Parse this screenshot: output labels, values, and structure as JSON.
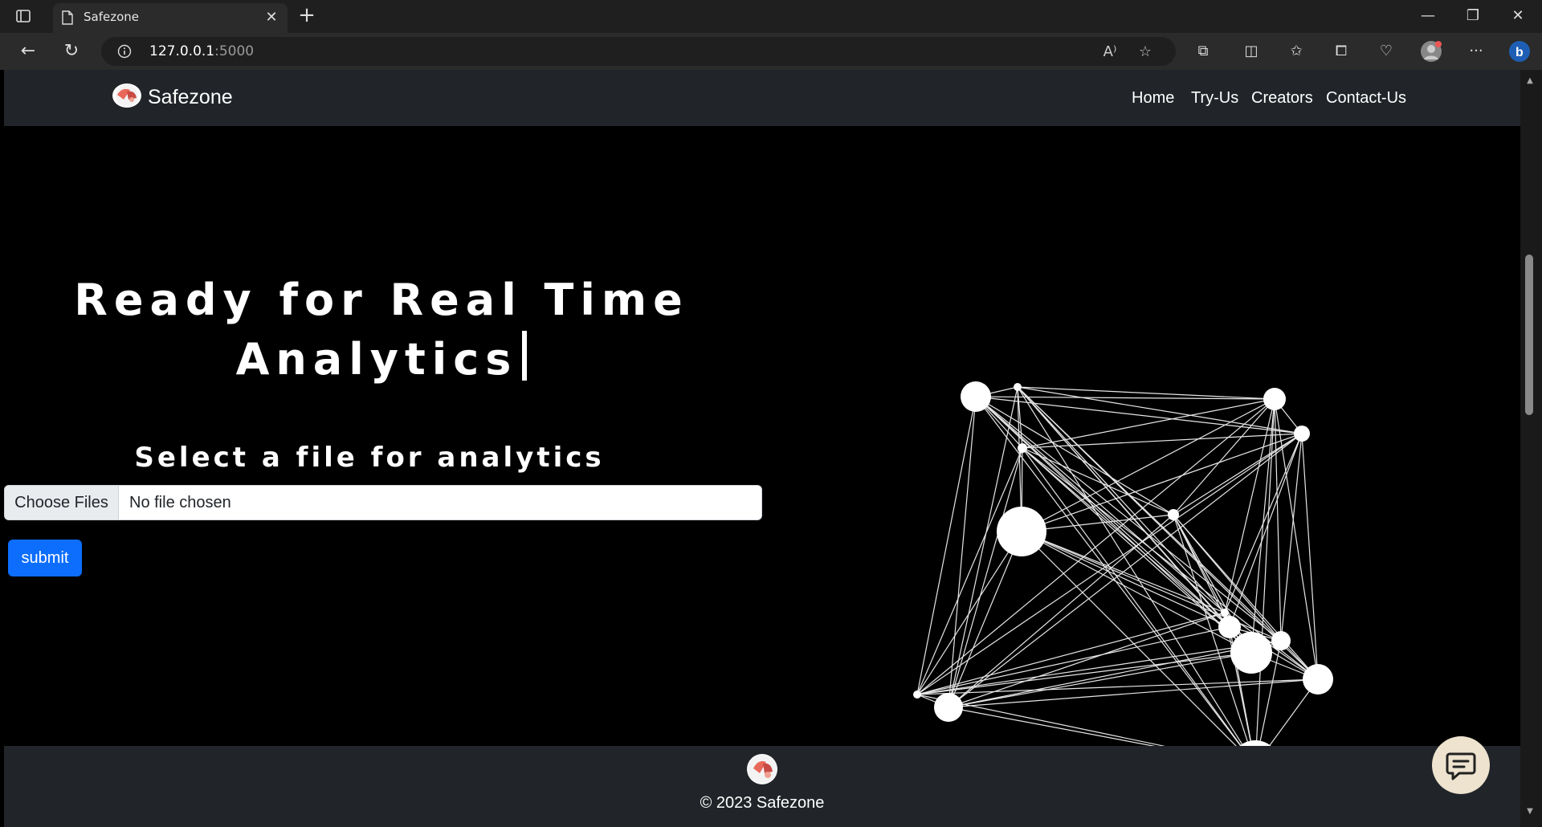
{
  "browser": {
    "tab_title": "Safezone",
    "url_host": "127.0.0.1",
    "url_port": ":5000"
  },
  "page": {
    "brand": "Safezone",
    "nav": [
      "Home",
      "Try-Us",
      "Creators",
      "Contact-Us"
    ],
    "hero_title": "Ready for Real Time Analytics",
    "subtitle": "Select a file for analytics",
    "file_button": "Choose Files",
    "file_status": "No file chosen",
    "submit_label": "submit",
    "footer_text": "© 2023 Safezone"
  },
  "colors": {
    "navbar_bg": "#212529",
    "submit_bg": "#0d6efd",
    "page_bg": "#000000",
    "chat_bg": "#ede3cf"
  }
}
